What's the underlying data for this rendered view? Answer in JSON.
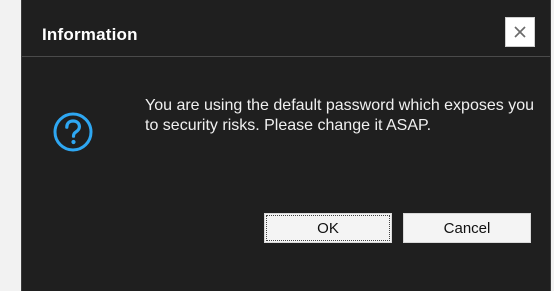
{
  "dialog": {
    "title": "Information",
    "message": "You are using the default password which exposes you to security risks. Please change it ASAP.",
    "icon": "question-circle-icon",
    "close_icon": "close-icon",
    "buttons": {
      "ok_label": "OK",
      "cancel_label": "Cancel"
    }
  },
  "colors": {
    "dialog_background": "#1f1f1f",
    "icon_accent": "#2ea7f2",
    "text": "#f0f0f0",
    "button_background": "#f4f4f4"
  }
}
